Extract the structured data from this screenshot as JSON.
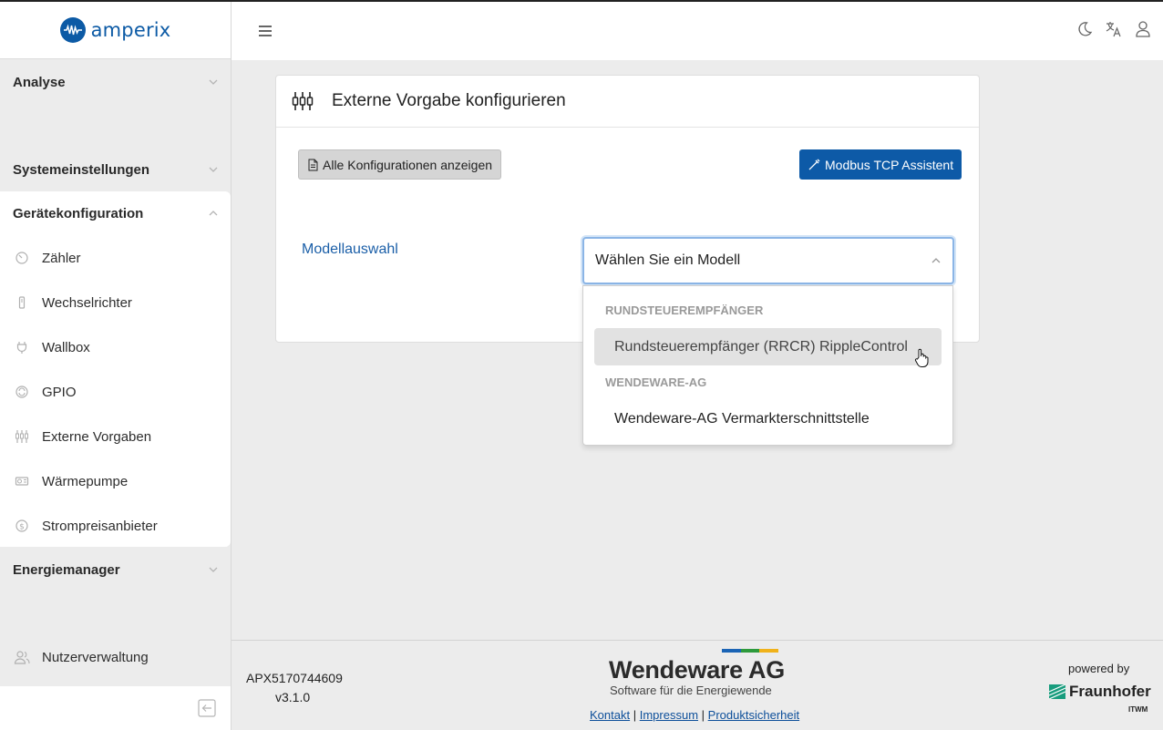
{
  "app": {
    "name": "amperix"
  },
  "sidebar": {
    "sections": [
      {
        "label": "Analyse"
      },
      {
        "label": "Systemeinstellungen"
      },
      {
        "label": "Gerätekonfiguration"
      },
      {
        "label": "Energiemanager"
      }
    ],
    "items": [
      {
        "label": "Zähler",
        "icon": "meter-icon"
      },
      {
        "label": "Wechselrichter",
        "icon": "inverter-icon"
      },
      {
        "label": "Wallbox",
        "icon": "plug-icon"
      },
      {
        "label": "GPIO",
        "icon": "gpio-icon"
      },
      {
        "label": "Externe Vorgaben",
        "icon": "sliders-icon"
      },
      {
        "label": "Wärmepumpe",
        "icon": "heatpump-icon"
      },
      {
        "label": "Strompreisanbieter",
        "icon": "dollar-icon"
      }
    ],
    "user_admin": {
      "label": "Nutzerverwaltung",
      "icon": "users-icon"
    }
  },
  "card": {
    "title": "Externe Vorgabe konfigurieren",
    "show_all_label": "Alle Konfigurationen anzeigen",
    "modbus_label": "Modbus TCP Assistent",
    "model_label": "Modellauswahl",
    "select_value": "Wählen Sie ein Modell"
  },
  "dropdown": {
    "groups": [
      {
        "label": "RUNDSTEUEREMPFÄNGER",
        "options": [
          "Rundsteuerempfänger (RRCR) RippleControl"
        ]
      },
      {
        "label": "WENDEWARE-AG",
        "options": [
          "Wendeware-AG Vermarkterschnittstelle"
        ]
      }
    ]
  },
  "footer": {
    "serial": "APX5170744609",
    "version": "v3.1.0",
    "company": "Wendeware AG",
    "tagline": "Software für die Energiewende",
    "links": [
      "Kontakt",
      "Impressum",
      "Produktsicherheit"
    ],
    "separator": "|",
    "powered_by": "powered by",
    "partner": "Fraunhofer",
    "partner_sub": "ITWM"
  },
  "colors": {
    "brand": "#0c5aa5",
    "accent_button": "#0d5aa7",
    "highlight": "#e2e2e2"
  }
}
